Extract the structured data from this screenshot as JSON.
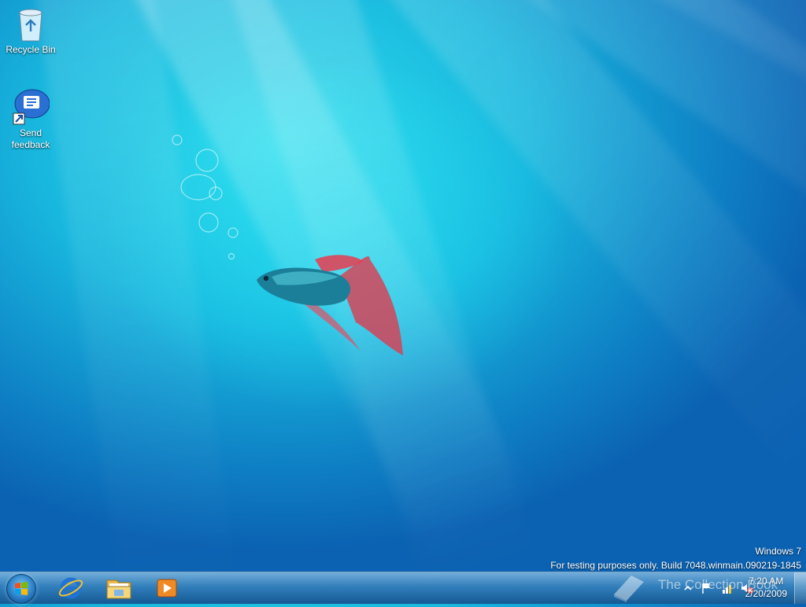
{
  "desktop": {
    "icons": [
      {
        "label": "Recycle Bin",
        "icon": "recycle-bin-icon"
      },
      {
        "label": "Send feedback",
        "icon": "send-feedback-icon"
      }
    ]
  },
  "watermark": {
    "line1": "Windows 7",
    "line2": "For testing purposes only. Build 7048.winmain.090219-1845",
    "overlay": "The Collection Book"
  },
  "taskbar": {
    "start": {
      "icon": "windows-start-orb-icon"
    },
    "pinned": [
      {
        "icon": "internet-explorer-icon"
      },
      {
        "icon": "windows-explorer-icon"
      },
      {
        "icon": "media-player-icon"
      }
    ],
    "tray": {
      "icons": [
        "show-hidden-icons-chevron",
        "action-center-flag-icon",
        "network-icon",
        "volume-muted-icon"
      ],
      "time": "7:20 AM",
      "date": "2/20/2009"
    }
  }
}
